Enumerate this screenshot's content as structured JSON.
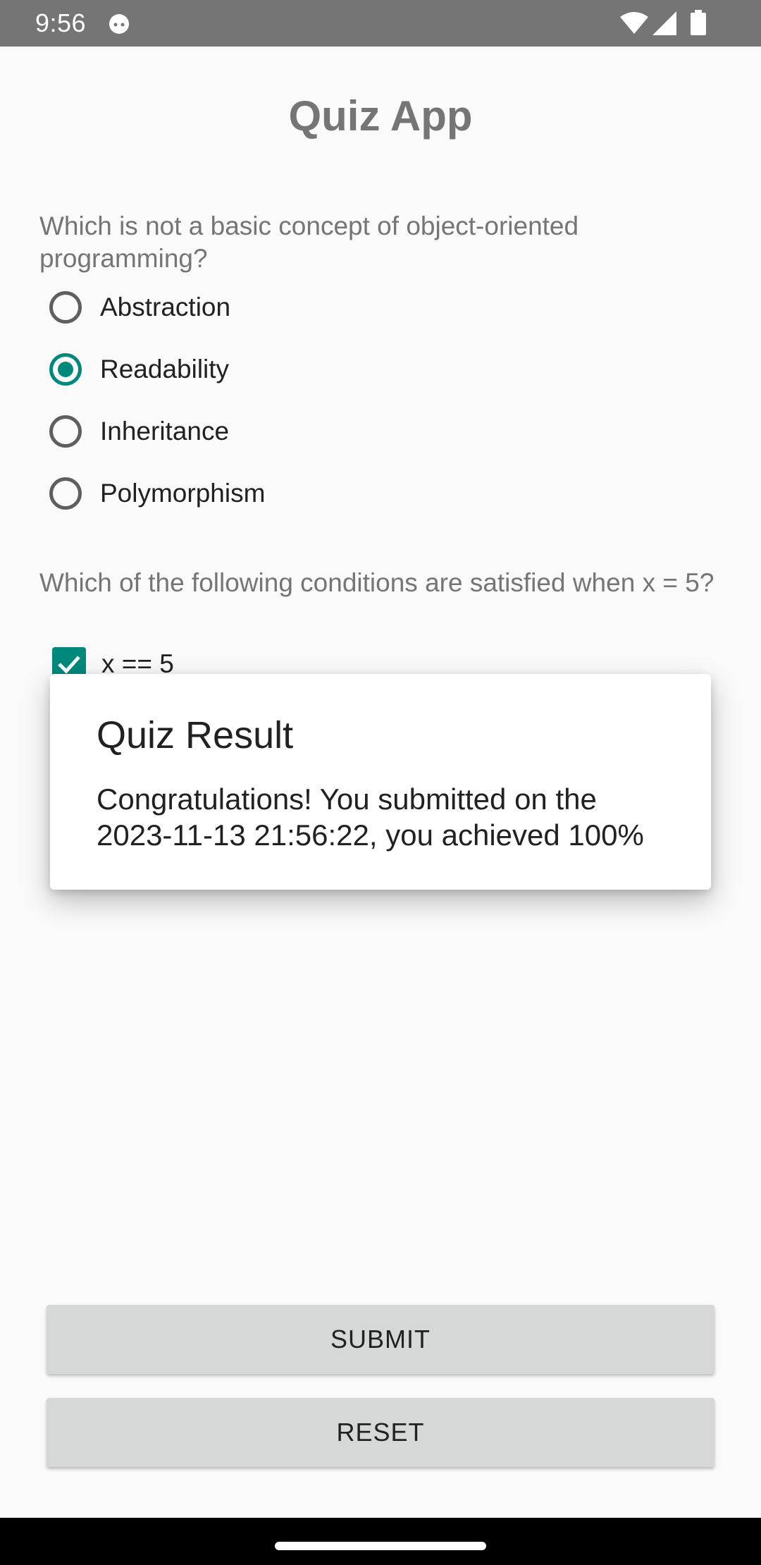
{
  "status_bar": {
    "time": "9:56",
    "icons": [
      "app-notification-icon",
      "wifi-icon",
      "signal-icon",
      "battery-icon"
    ]
  },
  "app": {
    "title": "Quiz App"
  },
  "quiz": {
    "question1": {
      "text": "Which is not a basic concept of object-oriented programming?",
      "options": [
        "Abstraction",
        "Readability",
        "Inheritance",
        "Polymorphism"
      ],
      "selected": "Readability"
    },
    "question2": {
      "text": "Which of the following conditions are satisfied when x = 5?",
      "options": [
        "x == 5"
      ],
      "checked": [
        "x == 5"
      ]
    }
  },
  "dialog": {
    "title": "Quiz Result",
    "message": "Congratulations! You submitted on the 2023-11-13 21:56:22, you achieved 100%"
  },
  "buttons": {
    "submit": "SUBMIT",
    "reset": "RESET"
  },
  "colors": {
    "accent": "#00897b",
    "status_bar": "#757575",
    "button_bg": "#d6d7d7",
    "background": "#fafafa"
  }
}
